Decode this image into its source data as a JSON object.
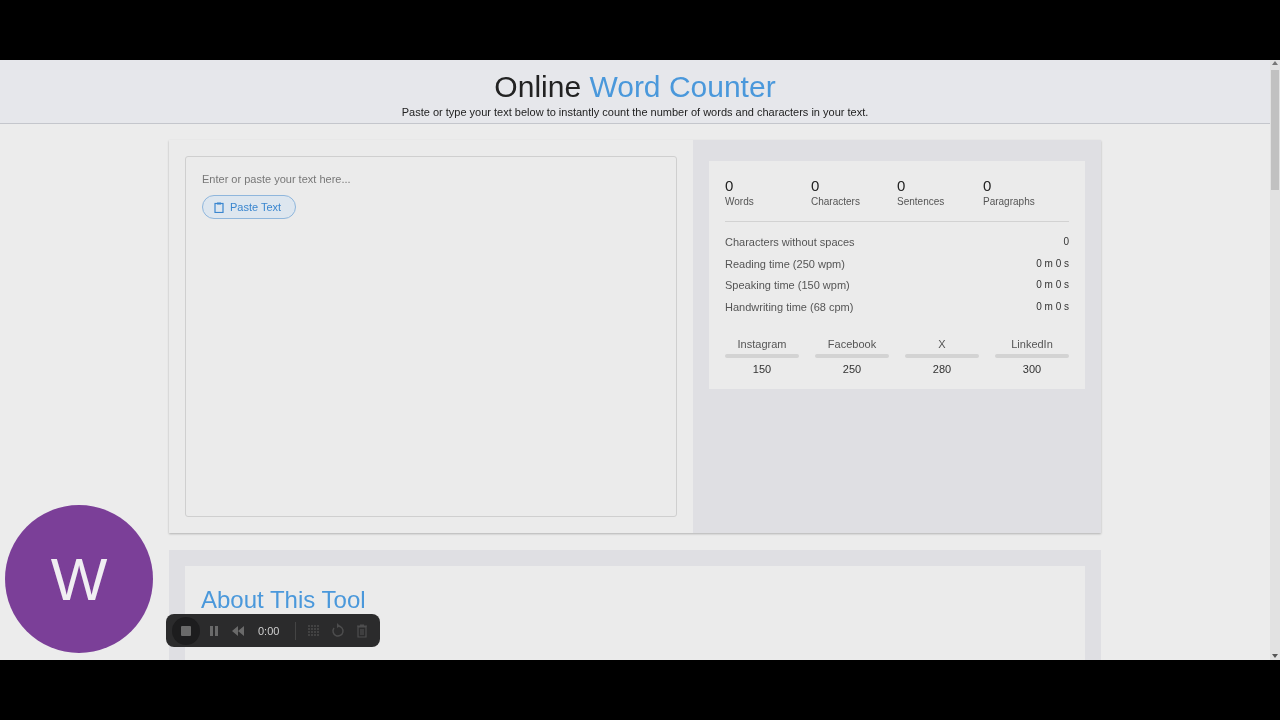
{
  "header": {
    "title_plain": "Online",
    "title_accent": "Word Counter",
    "subtitle": "Paste or type your text below to instantly count the number of words and characters in your text."
  },
  "editor": {
    "placeholder": "Enter or paste your text here...",
    "paste_button": "Paste Text"
  },
  "counts": [
    {
      "value": "0",
      "label": "Words"
    },
    {
      "value": "0",
      "label": "Characters"
    },
    {
      "value": "0",
      "label": "Sentences"
    },
    {
      "value": "0",
      "label": "Paragraphs"
    }
  ],
  "details": [
    {
      "label": "Characters without spaces",
      "value": "0"
    },
    {
      "label": "Reading time (250 wpm)",
      "value": "0 m 0 s"
    },
    {
      "label": "Speaking time (150 wpm)",
      "value": "0 m 0 s"
    },
    {
      "label": "Handwriting time (68 cpm)",
      "value": "0 m 0 s"
    }
  ],
  "social_limits": [
    {
      "name": "Instagram",
      "limit": "150"
    },
    {
      "name": "Facebook",
      "limit": "250"
    },
    {
      "name": "X",
      "limit": "280"
    },
    {
      "name": "LinkedIn",
      "limit": "300"
    }
  ],
  "about": {
    "heading": "About This Tool"
  },
  "avatar": {
    "letter": "W"
  },
  "recorder": {
    "time": "0:00",
    "controls": [
      {
        "kind": "stop",
        "disabled": false
      },
      {
        "kind": "pause",
        "disabled": false
      },
      {
        "kind": "rewind",
        "disabled": false
      },
      {
        "kind": "time"
      },
      {
        "kind": "grid",
        "disabled": true
      },
      {
        "kind": "reset",
        "disabled": true
      },
      {
        "kind": "trash",
        "disabled": true
      }
    ]
  }
}
